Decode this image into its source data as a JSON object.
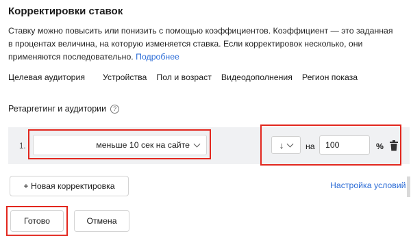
{
  "title": "Корректировки ставок",
  "description": {
    "text": "Ставку можно повысить или понизить с помощью коэффициентов. Коэффициент — это заданная в процентах величина, на которую изменяется ставка. Если корректировок несколько, они применяются последовательно.",
    "more_link": "Подробнее"
  },
  "tabs": [
    "Целевая аудитория",
    "Устройства",
    "Пол и возраст",
    "Видеодополнения",
    "Регион показа"
  ],
  "section_title": "Ретаргетинг и аудитории",
  "help_icon": "question-circle-icon",
  "adjustment": {
    "index": "1.",
    "condition": "меньше 10 сек на сайте",
    "direction": "↓",
    "on_label": "на",
    "value": "100",
    "unit": "%",
    "delete_icon": "trash-icon"
  },
  "buttons": {
    "new_adjustment": "+ Новая корректировка",
    "setup_conditions": "Настройка условий",
    "done": "Готово",
    "cancel": "Отмена"
  },
  "colors": {
    "highlight": "#e2261d",
    "link": "#2a6bd6",
    "row_background": "#f0f1f3"
  }
}
